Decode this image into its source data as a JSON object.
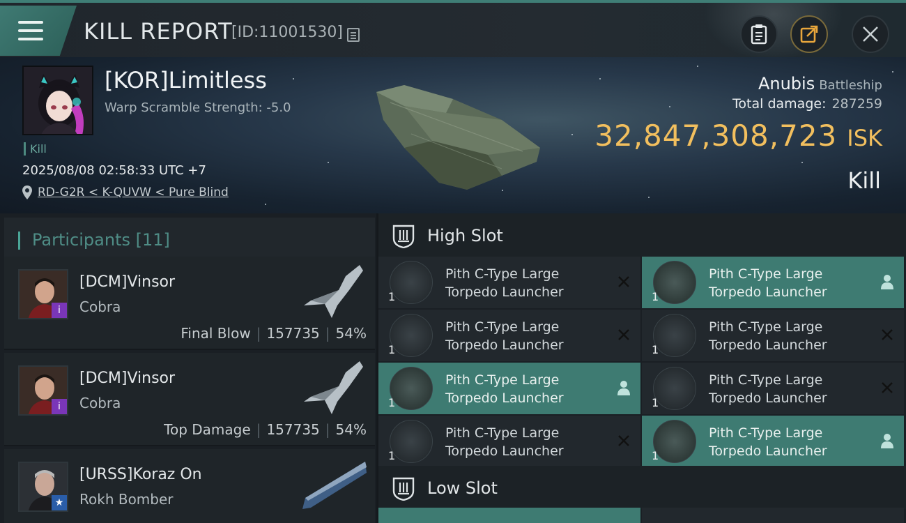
{
  "header": {
    "title": "KILL REPORT",
    "report_id": "[ID:11001530]"
  },
  "victim": {
    "name": "[KOR]Limitless",
    "warp_scramble": "Warp Scramble Strength: -5.0",
    "tag": "Kill",
    "datetime": "2025/08/08 02:58:33 UTC +7",
    "location": "RD-G2R < K-QUVW < Pure Blind",
    "ship_name": "Anubis",
    "ship_class": "Battleship",
    "damage_label": "Total damage:",
    "damage_value": "287259",
    "isk_amount": "32,847,308,723",
    "isk_currency": "ISK",
    "result": "Kill"
  },
  "participants": {
    "header": "Participants [11]",
    "rows": [
      {
        "name": "[DCM]Vinsor",
        "ship": "Cobra",
        "role": "Final Blow",
        "damage": "157735",
        "percent": "54%"
      },
      {
        "name": "[DCM]Vinsor",
        "ship": "Cobra",
        "role": "Top Damage",
        "damage": "157735",
        "percent": "54%"
      },
      {
        "name": "[URSS]Koraz On",
        "ship": "Rokh Bomber"
      }
    ]
  },
  "slots": {
    "high": {
      "label": "High Slot",
      "modules": [
        {
          "line1": "Pith C-Type Large",
          "line2": "Torpedo Launcher",
          "qty": "1",
          "status": "destroyed"
        },
        {
          "line1": "Pith C-Type Large",
          "line2": "Torpedo Launcher",
          "qty": "1",
          "status": "dropped"
        },
        {
          "line1": "Pith C-Type Large",
          "line2": "Torpedo Launcher",
          "qty": "1",
          "status": "destroyed"
        },
        {
          "line1": "Pith C-Type Large",
          "line2": "Torpedo Launcher",
          "qty": "1",
          "status": "destroyed"
        },
        {
          "line1": "Pith C-Type Large",
          "line2": "Torpedo Launcher",
          "qty": "1",
          "status": "dropped"
        },
        {
          "line1": "Pith C-Type Large",
          "line2": "Torpedo Launcher",
          "qty": "1",
          "status": "destroyed"
        },
        {
          "line1": "Pith C-Type Large",
          "line2": "Torpedo Launcher",
          "qty": "1",
          "status": "destroyed"
        },
        {
          "line1": "Pith C-Type Large",
          "line2": "Torpedo Launcher",
          "qty": "1",
          "status": "dropped"
        }
      ]
    },
    "low": {
      "label": "Low Slot"
    }
  },
  "colors": {
    "accent": "#3e7b72",
    "isk": "#f2bf5e",
    "panel": "#22282d"
  },
  "icons": {
    "menu": "hamburger-icon",
    "copy": "copy-icon",
    "clipboard": "clipboard-icon",
    "share": "share-icon",
    "close": "close-icon",
    "location": "location-pin-icon",
    "slot": "shield-slot-icon",
    "destroyed": "x-mark-icon",
    "dropped": "person-icon"
  }
}
